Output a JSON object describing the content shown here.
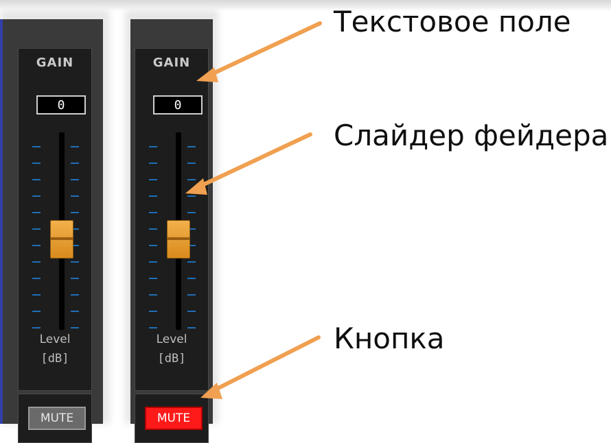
{
  "channels": [
    {
      "name": "channel-1",
      "gain_title": "GAIN",
      "gain_value": "0",
      "fader_level_fraction": 0.46,
      "level_label": "Level",
      "unit_label": "[dB]",
      "mute_label": "MUTE",
      "mute_active": false
    },
    {
      "name": "channel-2",
      "gain_title": "GAIN",
      "gain_value": "0",
      "fader_level_fraction": 0.46,
      "level_label": "Level",
      "unit_label": "[dB]",
      "mute_label": "MUTE",
      "mute_active": true
    }
  ],
  "annotations": {
    "text_field": "Текстовое поле",
    "fader_slider": "Слайдер фейдера",
    "button": "Кнопка"
  },
  "colors": {
    "fader": "#e9a23a",
    "mute_active": "#ff1a1a",
    "mute_inactive": "#6a6a6a",
    "arrow": "#f0a050",
    "scale_ticks": "#1f6fb8"
  }
}
